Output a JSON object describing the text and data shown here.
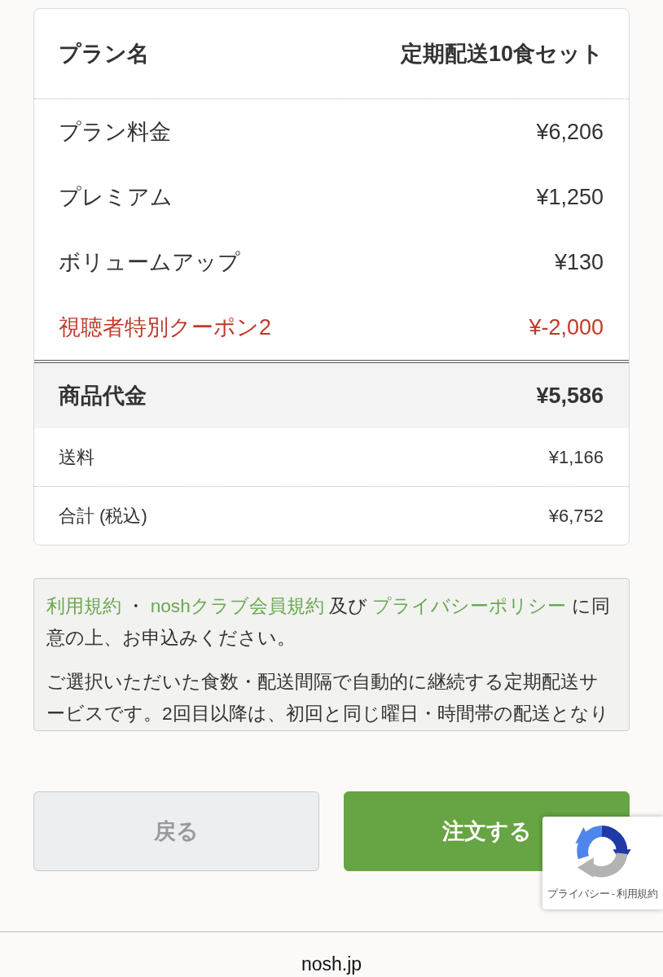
{
  "summary": {
    "header": {
      "label": "プラン名",
      "value": "定期配送10食セット"
    },
    "items": [
      {
        "label": "プラン料金",
        "value": "¥6,206",
        "kind": "charge"
      },
      {
        "label": "プレミアム",
        "value": "¥1,250",
        "kind": "charge"
      },
      {
        "label": "ボリュームアップ",
        "value": "¥130",
        "kind": "charge"
      },
      {
        "label": "視聴者特別クーポン2",
        "value": "¥-2,000",
        "kind": "discount"
      }
    ],
    "subtotal": {
      "label": "商品代金",
      "value": "¥5,586"
    },
    "fees": [
      {
        "label": "送料",
        "value": "¥1,166"
      },
      {
        "label": "合計 (税込)",
        "value": "¥6,752"
      }
    ]
  },
  "notice": {
    "agreement": [
      {
        "kind": "link",
        "text": "利用規約"
      },
      {
        "kind": "text",
        "text": "・"
      },
      {
        "kind": "link",
        "text": "noshクラブ会員規約"
      },
      {
        "kind": "text",
        "text": "及び"
      },
      {
        "kind": "link",
        "text": "プライバシーポリシー"
      },
      {
        "kind": "text",
        "text": "に同意の上、お申込みください。"
      }
    ],
    "description": "ご選択いただいた食数・配送間隔で自動的に継続する定期配送サービスです。2回目以降は、初回と同じ曜日・時間帯の配送となり"
  },
  "buttons": [
    {
      "label": "戻る",
      "kind": "secondary"
    },
    {
      "label": "注文する",
      "kind": "primary"
    }
  ],
  "recaptcha": {
    "links": [
      "プライバシー",
      "利用規約"
    ],
    "separator": "-"
  },
  "footer": {
    "domain": "nosh.jp"
  }
}
